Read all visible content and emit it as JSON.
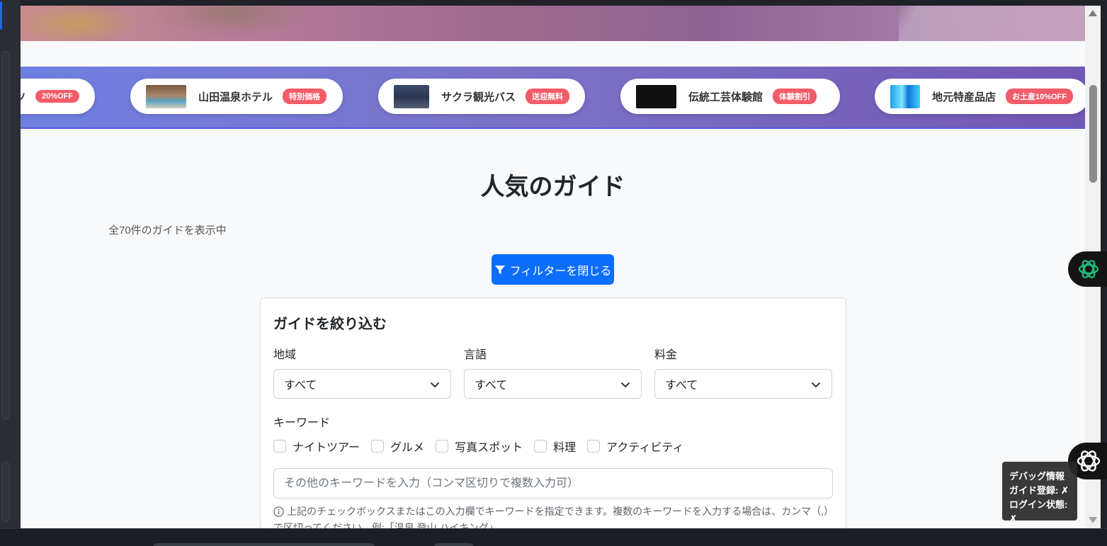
{
  "sponsors": [
    {
      "name": "",
      "badge": "20%OFF",
      "thumb": "partial"
    },
    {
      "name": "山田温泉ホテル",
      "badge": "特別価格",
      "thumb": "hotel-photo"
    },
    {
      "name": "サクラ観光バス",
      "badge": "送迎無料",
      "thumb": "bus-photo"
    },
    {
      "name": "伝統工芸体験館",
      "badge": "体験割引",
      "thumb": "craft-photo"
    },
    {
      "name": "地元特産品店",
      "badge": "お土産10%OFF",
      "thumb": "shop-photo"
    }
  ],
  "page": {
    "title": "人気のガイド",
    "result_count": "全70件のガイドを表示中",
    "filter_toggle_label": "フィルターを閉じる"
  },
  "filters": {
    "heading": "ガイドを絞り込む",
    "region": {
      "label": "地域",
      "value": "すべて"
    },
    "language": {
      "label": "言語",
      "value": "すべて"
    },
    "price": {
      "label": "料金",
      "value": "すべて"
    },
    "keyword_label": "キーワード",
    "keyword_checkboxes": [
      {
        "label": "ナイトツアー",
        "checked": false
      },
      {
        "label": "グルメ",
        "checked": false
      },
      {
        "label": "写真スポット",
        "checked": false
      },
      {
        "label": "料理",
        "checked": false
      },
      {
        "label": "アクティビティ",
        "checked": false
      }
    ],
    "keyword_placeholder": "その他のキーワードを入力（コンマ区切りで複数入力可）",
    "help_text": "上記のチェックボックスまたはこの入力欄でキーワードを指定できます。複数のキーワードを入力する場合は、カンマ（,）で区切ってください。例:「温泉,登山,ハイキング」"
  },
  "debug": {
    "title": "デバッグ情報",
    "guide_registered": "ガイド登録: ✗",
    "login_state": "ログイン状態: ✗"
  },
  "colors": {
    "primary": "#0d6efd",
    "badge": "#f25c69",
    "band_start": "#6f7fe0",
    "band_end": "#7258b5"
  },
  "icons": {
    "filter_button": "funnel-icon",
    "select": "chevron-down-icon",
    "help": "info-icon",
    "float_top": "openai-logo-icon",
    "float_bottom": "ai-assistant-icon"
  }
}
